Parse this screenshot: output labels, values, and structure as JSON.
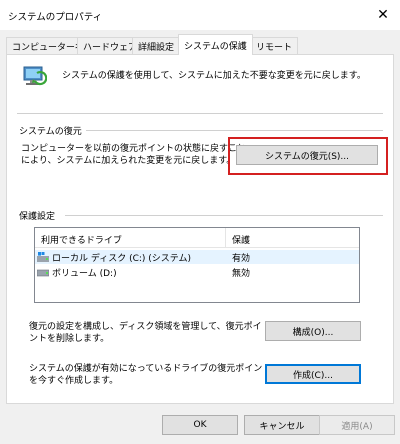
{
  "window": {
    "title": "システムのプロパティ",
    "close_glyph": "✕"
  },
  "tabs": [
    {
      "label": "コンピューター名",
      "active": false
    },
    {
      "label": "ハードウェア",
      "active": false
    },
    {
      "label": "詳細設定",
      "active": false
    },
    {
      "label": "システムの保護",
      "active": true
    },
    {
      "label": "リモート",
      "active": false
    }
  ],
  "intro": {
    "icon": "system-protection-icon",
    "text": "システムの保護を使用して、システムに加えた不要な変更を元に戻します。"
  },
  "restore": {
    "heading": "システムの復元",
    "desc_line1": "コンピューターを以前の復元ポイントの状態に戻すこと",
    "desc_line2": "により、システムに加えられた変更を元に戻します。",
    "button": "システムの復元(S)..."
  },
  "protection": {
    "heading": "保護設定",
    "columns": [
      "利用できるドライブ",
      "保護"
    ],
    "drives": [
      {
        "icon": "windows-drive-icon",
        "name": "ローカル ディスク (C:) (システム)",
        "status": "有効"
      },
      {
        "icon": "drive-icon",
        "name": "ボリューム (D:)",
        "status": "無効"
      }
    ],
    "configure_line1": "復元の設定を構成し、ディスク領域を管理して、復元ポイ",
    "configure_line2": "ントを削除します。",
    "configure_button": "構成(O)...",
    "create_line1": "システムの保護が有効になっているドライブの復元ポイント",
    "create_line2": "を今すぐ作成します。",
    "create_button": "作成(C)..."
  },
  "footer": {
    "ok": "OK",
    "cancel": "キャンセル",
    "apply": "適用(A)"
  },
  "colors": {
    "highlight": "#d42020",
    "focus": "#0078d7",
    "selected_row": "#e5f3ff"
  }
}
